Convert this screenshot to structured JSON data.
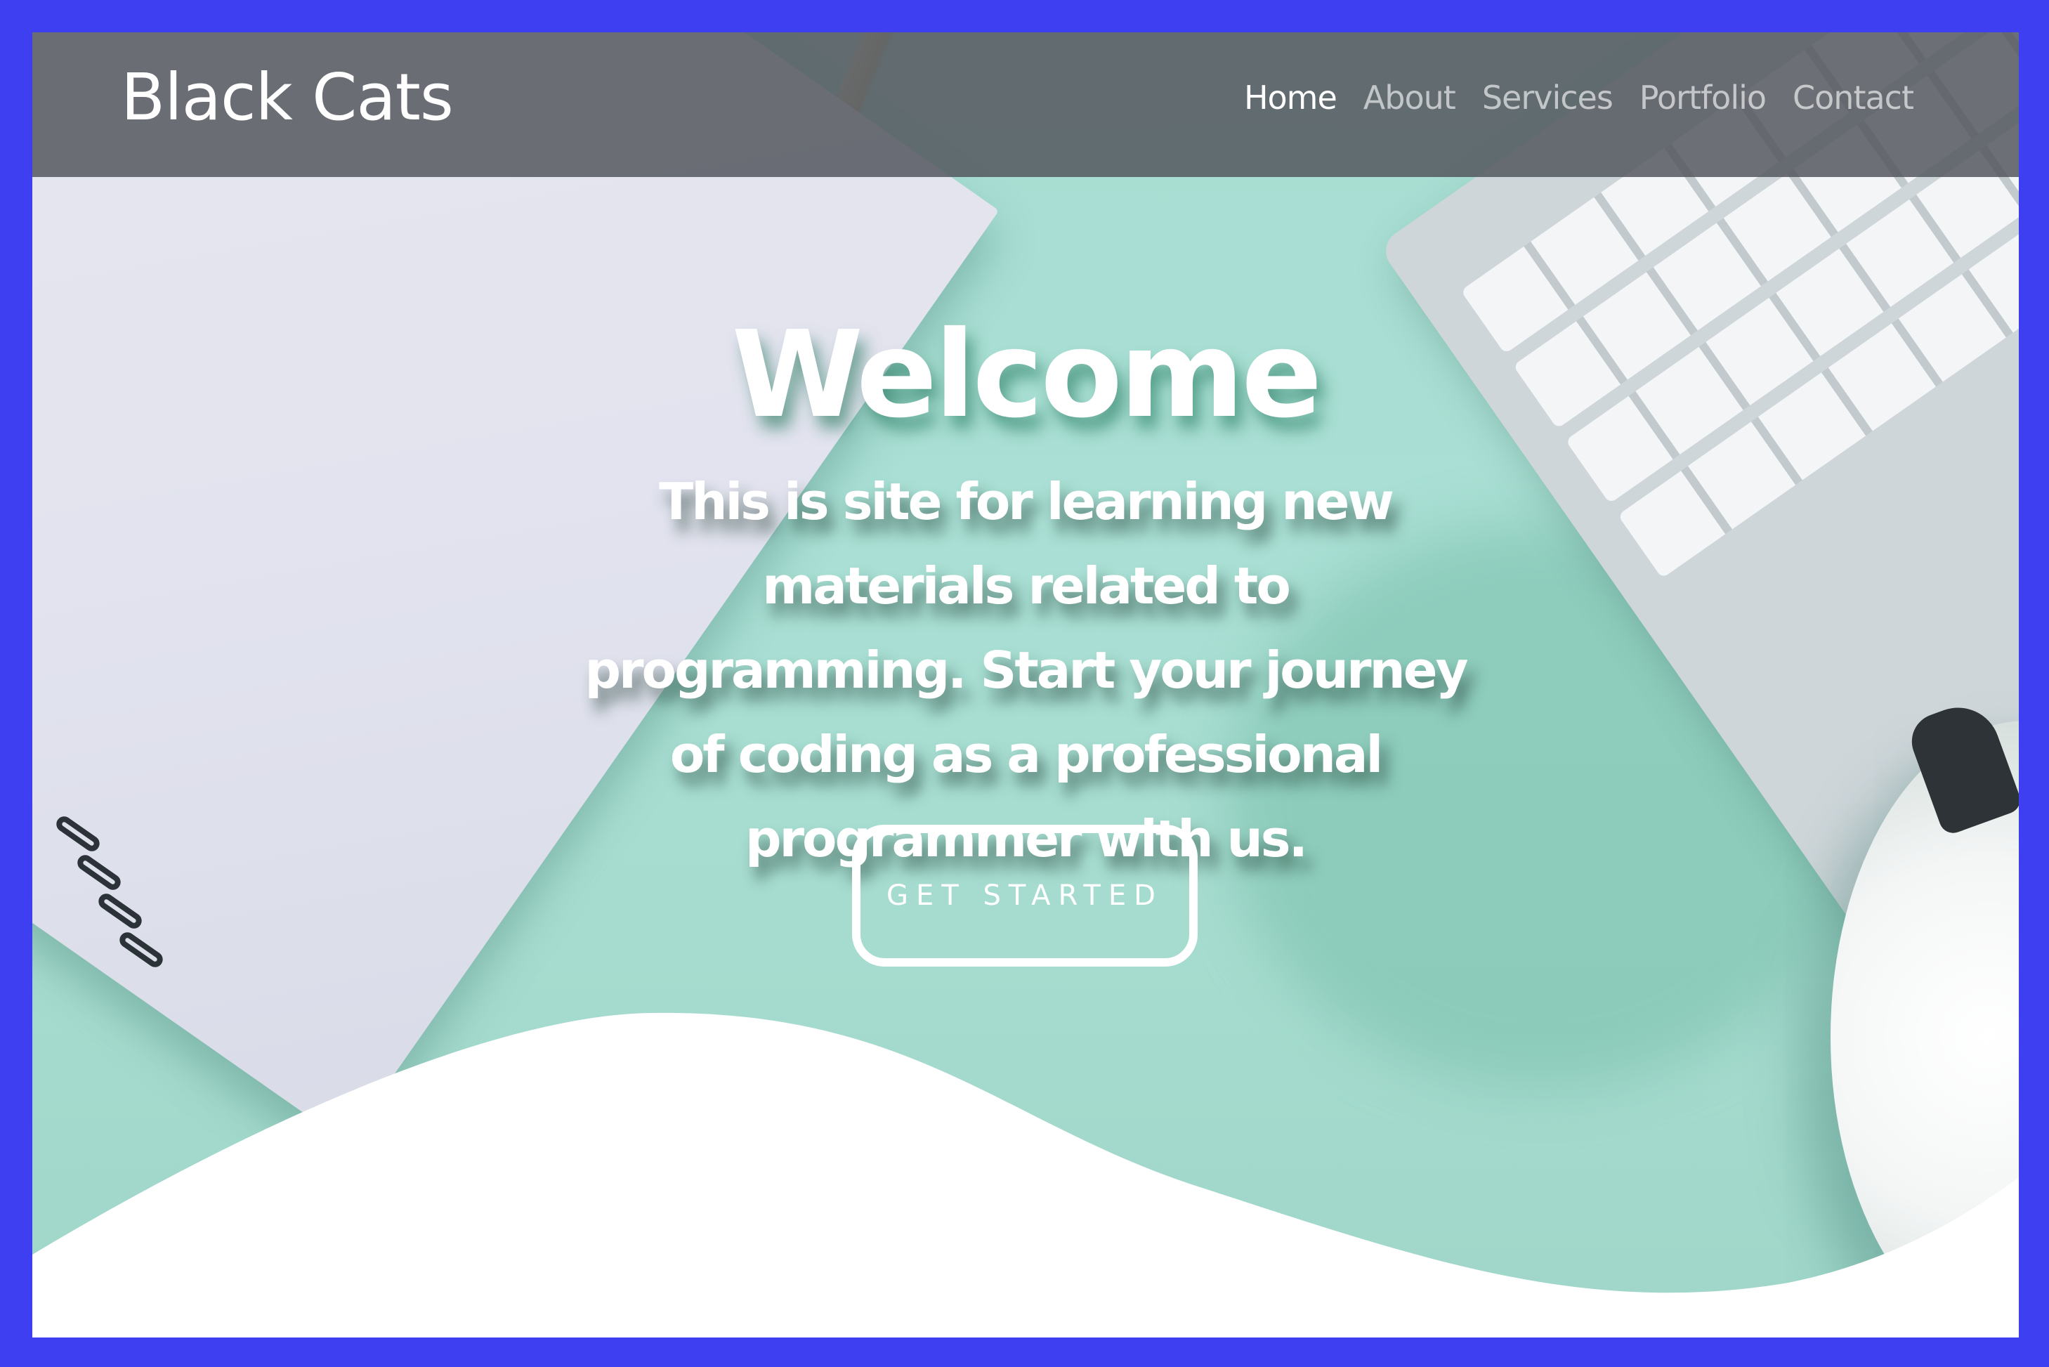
{
  "header": {
    "brand": "Black Cats",
    "nav": [
      {
        "label": "Home",
        "active": true
      },
      {
        "label": "About",
        "active": false
      },
      {
        "label": "Services",
        "active": false
      },
      {
        "label": "Portfolio",
        "active": false
      },
      {
        "label": "Contact",
        "active": false
      }
    ]
  },
  "hero": {
    "title": "Welcome",
    "subtitle": "This is site for learning new materials related to programming. Start your journey of coding as a professional programmer with us.",
    "cta_label": "GET STARTED"
  },
  "colors": {
    "frame_border": "#3f3ff2",
    "hero_background": "#a7ddd2",
    "navbar": "#555860",
    "text": "#ffffff"
  }
}
